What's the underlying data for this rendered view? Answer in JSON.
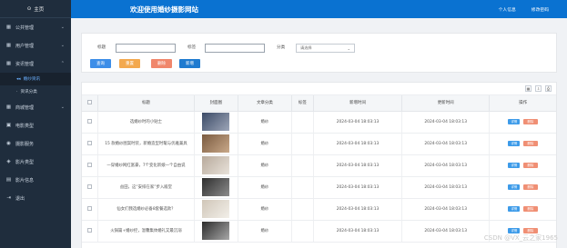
{
  "sidebar": {
    "top_label": "主页",
    "items": [
      {
        "label": "公共管理",
        "icon": "grid-icon",
        "chev": "v"
      },
      {
        "label": "用户管理",
        "icon": "grid-icon",
        "chev": "v"
      },
      {
        "label": "资讯管理",
        "icon": "grid-icon",
        "chev": "^"
      },
      {
        "label": "商城管理",
        "icon": "grid-icon",
        "chev": "v"
      },
      {
        "label": "电影类型",
        "icon": "film-icon",
        "chev": ""
      },
      {
        "label": "摄影服务",
        "icon": "camera-icon",
        "chev": ""
      },
      {
        "label": "影片类型",
        "icon": "tag-icon",
        "chev": ""
      },
      {
        "label": "影片信息",
        "icon": "info-icon",
        "chev": ""
      },
      {
        "label": "退出",
        "icon": "exit-icon",
        "chev": ""
      }
    ],
    "subitems": [
      {
        "label": "婚纱资讯",
        "active": true
      },
      {
        "label": "资讯分类",
        "active": false
      }
    ]
  },
  "header": {
    "title": "欢迎使用婚纱摄影网站",
    "links": [
      "个人信息",
      "修改密码"
    ]
  },
  "search": {
    "label1": "标题",
    "label2": "标签",
    "label3": "分类",
    "select_placeholder": "请选择",
    "buttons": {
      "query": "查询",
      "reset": "重置",
      "delete": "删除",
      "add": "新增"
    }
  },
  "table": {
    "headers": [
      "标题",
      "封面图",
      "文章分类",
      "标签",
      "新增时间",
      "更新时间",
      "操作"
    ],
    "actions": {
      "detail": "详情",
      "delete": "删除"
    },
    "rows": [
      {
        "title": "选婚纱时的小贴士",
        "category": "婚纱",
        "tag": "",
        "created": "2024-03-04 18:03:13",
        "updated": "2024-03-04 18:03:13",
        "thumb": [
          "#3b4a66",
          "#9da6b8"
        ]
      },
      {
        "title": "15 款婚纱图案时装，新婚造型时髦与优雅兼具",
        "category": "婚纱",
        "tag": "",
        "created": "2024-03-04 18:03:13",
        "updated": "2024-03-04 18:03:13",
        "thumb": [
          "#7a5a3f",
          "#c9a98a"
        ]
      },
      {
        "title": "一穿婚纱网红富豪，7个变化新娘一个自由说",
        "category": "婚纱",
        "tag": "",
        "created": "2024-03-04 18:03:13",
        "updated": "2024-03-04 18:03:13",
        "thumb": [
          "#b8aa9c",
          "#e8e2da"
        ]
      },
      {
        "title": "益田，这“安排在家”步入殿堂",
        "category": "婚纱",
        "tag": "",
        "created": "2024-03-04 18:03:13",
        "updated": "2024-03-04 18:03:13",
        "thumb": [
          "#2e2e2e",
          "#8c8c8c"
        ]
      },
      {
        "title": "仙女们我选婚纱必备8套餐选款？",
        "category": "婚纱",
        "tag": "",
        "created": "2024-03-04 18:03:13",
        "updated": "2024-03-04 18:03:13",
        "thumb": [
          "#d0c6b8",
          "#f2efe9"
        ]
      },
      {
        "title": "火锅篇+婚纱控，温馨集体婚礼又最沉溺",
        "category": "婚纱",
        "tag": "",
        "created": "2024-03-04 18:03:13",
        "updated": "2024-03-04 18:03:13",
        "thumb": [
          "#2b2b2b",
          "#a8a8a8"
        ]
      }
    ]
  },
  "watermark": "CSDN @VX_云之家1965",
  "colors": {
    "header": "#0a72d1",
    "sidebar": "#1f2d3d",
    "query": "#3d8ee8",
    "reset": "#f3a94f",
    "delete": "#f0876c",
    "add": "#1f7bd0"
  }
}
